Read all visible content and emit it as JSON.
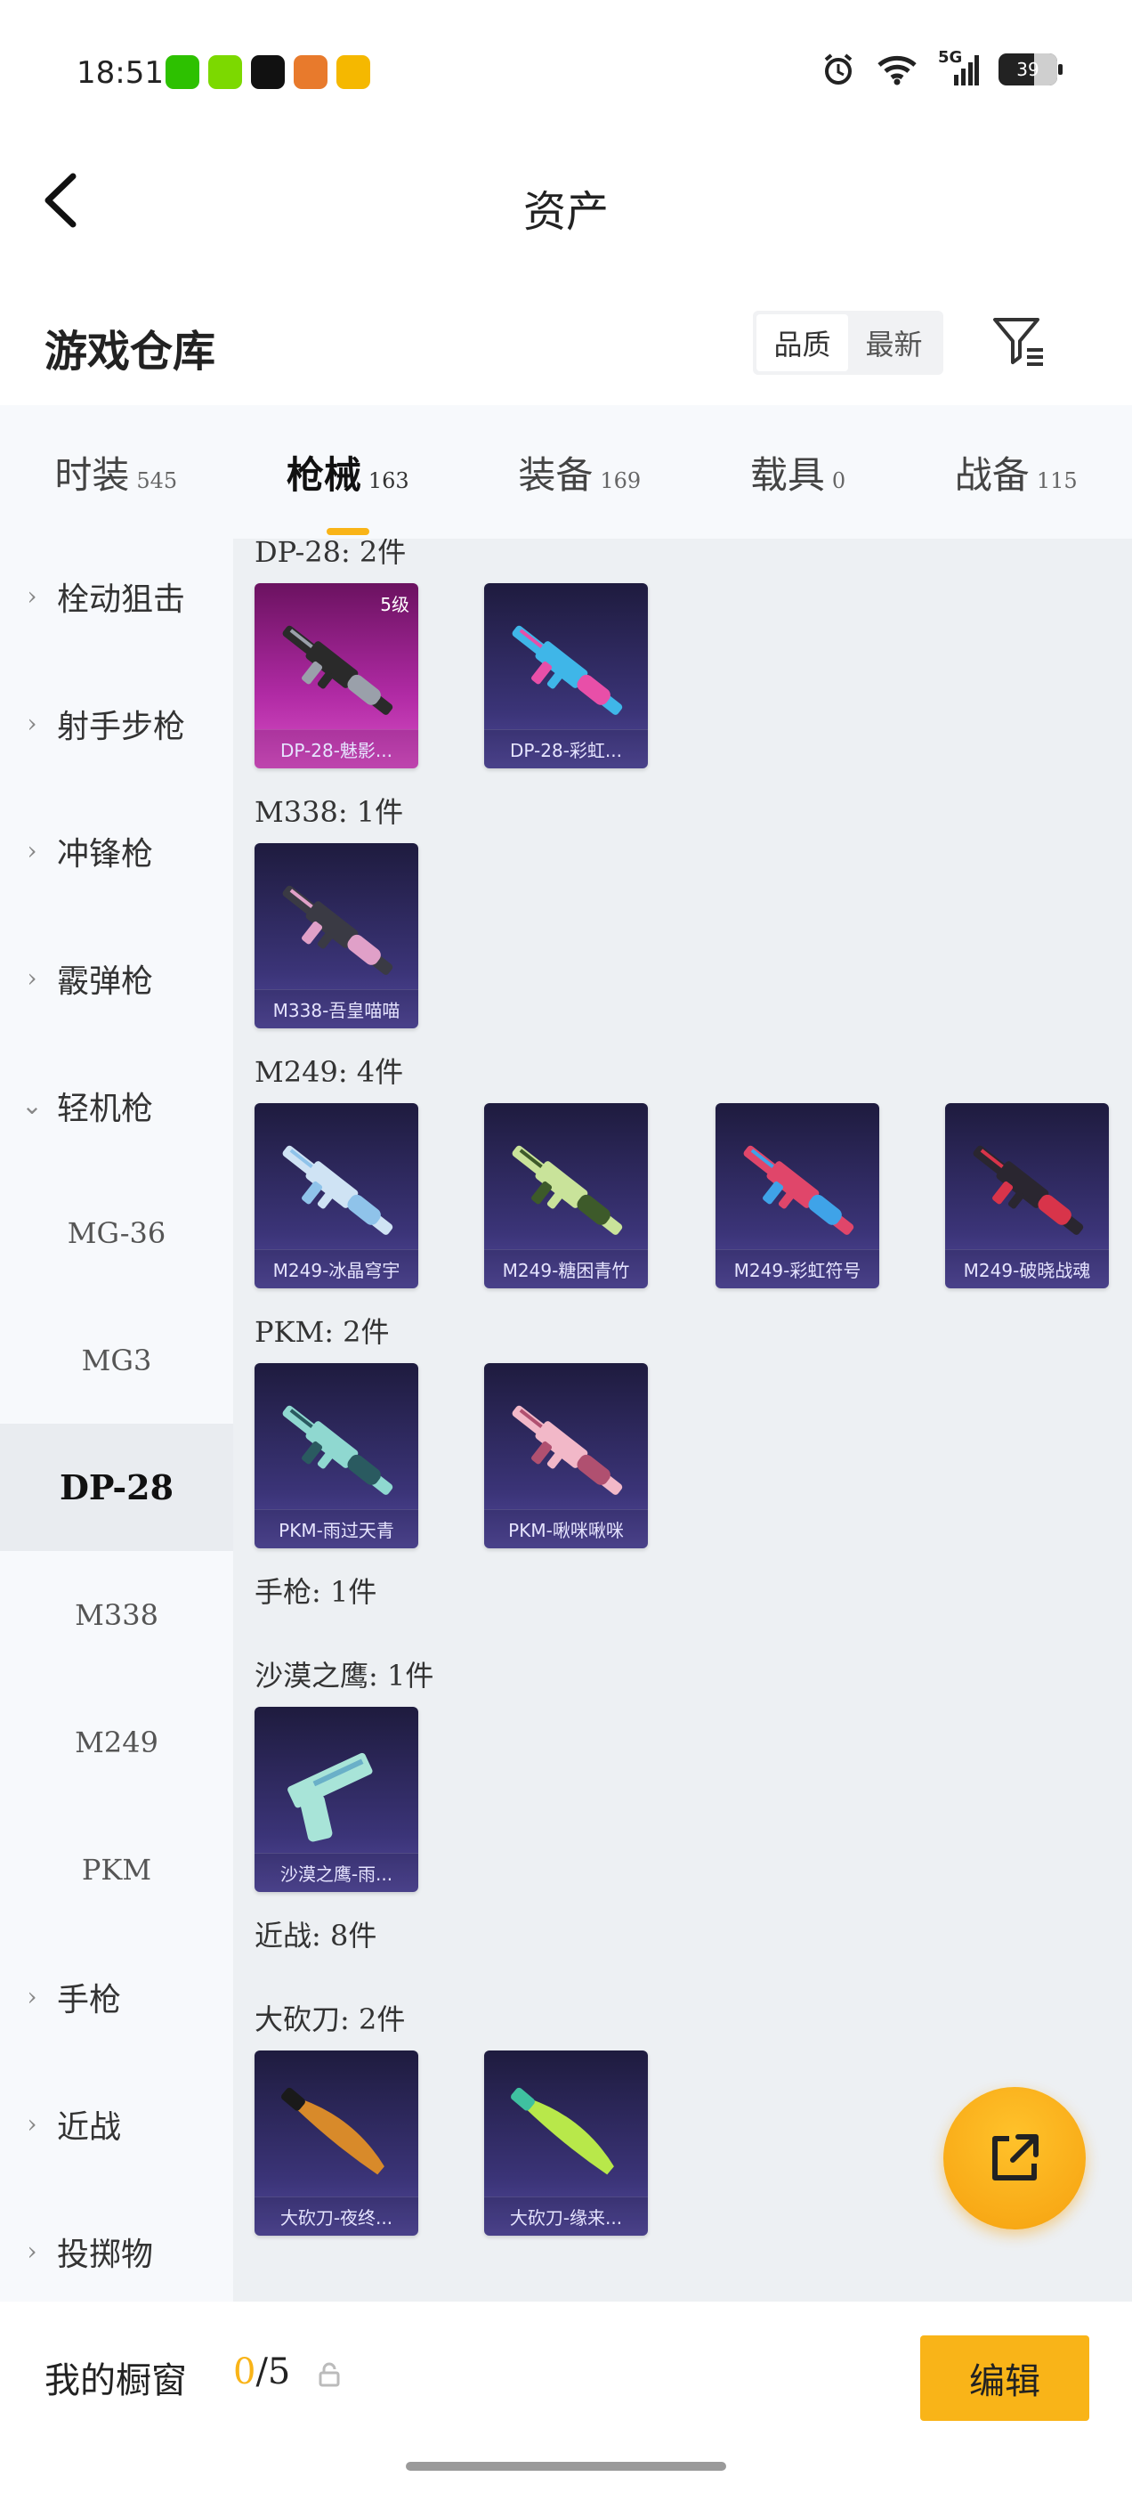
{
  "status_bar": {
    "time": "18:51",
    "battery": "39",
    "network": "5G",
    "app_icons": [
      {
        "name": "wechat-icon",
        "color": "#2dc100"
      },
      {
        "name": "green-dot-app-icon",
        "color": "#7cd900"
      },
      {
        "name": "tiktok-icon",
        "color": "#111111"
      },
      {
        "name": "game-avatar-icon",
        "color": "#e87a2c"
      },
      {
        "name": "weibo-icon",
        "color": "#f5b800"
      }
    ]
  },
  "header": {
    "title": "资产"
  },
  "warehouse": {
    "title": "游戏仓库",
    "sort_options": [
      "品质",
      "最新"
    ],
    "active_sort": "品质"
  },
  "tabs": [
    {
      "label": "时装",
      "count": "545"
    },
    {
      "label": "枪械",
      "count": "163",
      "active": true
    },
    {
      "label": "装备",
      "count": "169"
    },
    {
      "label": "载具",
      "count": "0"
    },
    {
      "label": "战备",
      "count": "115"
    }
  ],
  "sidebar": {
    "items": [
      {
        "label": "栓动狙击",
        "chevron": "›"
      },
      {
        "label": "射手步枪",
        "chevron": "›"
      },
      {
        "label": "冲锋枪",
        "chevron": "›"
      },
      {
        "label": "霰弹枪",
        "chevron": "›"
      },
      {
        "label": "轻机枪",
        "chevron": "⌄"
      },
      {
        "label": "MG-36"
      },
      {
        "label": "MG3"
      },
      {
        "label": "DP-28",
        "selected": true
      },
      {
        "label": "M338"
      },
      {
        "label": "M249"
      },
      {
        "label": "PKM"
      },
      {
        "label": "手枪",
        "chevron": "›"
      },
      {
        "label": "近战",
        "chevron": "›"
      },
      {
        "label": "投掷物",
        "chevron": "›"
      }
    ]
  },
  "content": {
    "groups": [
      {
        "label": "DP-28: 2件",
        "cards": [
          {
            "label": "DP-28-魅影...",
            "level": "5级",
            "style": "pink",
            "weapon_color": "#2a2a2a",
            "accent": "#9aa0aa"
          },
          {
            "label": "DP-28-彩虹...",
            "style": "blue",
            "weapon_color": "#3fb6e8",
            "accent": "#e84fa8"
          }
        ]
      },
      {
        "label": "M338: 1件",
        "cards": [
          {
            "label": "M338-吾皇喵喵",
            "style": "blue",
            "weapon_color": "#3a3a44",
            "accent": "#e0a0c8"
          }
        ]
      },
      {
        "label": "M249: 4件",
        "cards": [
          {
            "label": "M249-冰晶穹宇",
            "style": "blue",
            "weapon_color": "#cfe3f4",
            "accent": "#8fc3ea"
          },
          {
            "label": "M249-糖困青竹",
            "style": "blue",
            "weapon_color": "#c9e39a",
            "accent": "#3d5a2a"
          },
          {
            "label": "M249-彩虹符号",
            "style": "blue",
            "weapon_color": "#e0466a",
            "accent": "#3fa3e8"
          },
          {
            "label": "M249-破晓战魂",
            "style": "blue",
            "weapon_color": "#2a2630",
            "accent": "#d8344a"
          }
        ]
      },
      {
        "label": "PKM: 2件",
        "cards": [
          {
            "label": "PKM-雨过天青",
            "style": "blue",
            "weapon_color": "#8fd8d0",
            "accent": "#2a5a60"
          },
          {
            "label": "PKM-啾咪啾咪",
            "style": "blue",
            "weapon_color": "#f2b8c8",
            "accent": "#b05070"
          }
        ]
      },
      {
        "label": "手枪: 1件",
        "cards": []
      },
      {
        "label": "沙漠之鹰: 1件",
        "cards": [
          {
            "label": "沙漠之鹰-雨...",
            "style": "blue",
            "weapon_color": "#a8e4d8",
            "accent": "#6ab0c8"
          }
        ]
      },
      {
        "label": "近战: 8件",
        "cards": []
      },
      {
        "label": "大砍刀: 2件",
        "cards": [
          {
            "label": "大砍刀-夜终...",
            "style": "blue",
            "weapon_color": "#d88a2a",
            "accent": "#1a1a1a"
          },
          {
            "label": "大砍刀-缘来...",
            "style": "blue",
            "weapon_color": "#b8e84a",
            "accent": "#3fc0a0"
          }
        ]
      }
    ]
  },
  "bottom": {
    "showcase_label": "我的橱窗",
    "showcase_current": "0",
    "showcase_total": "/5",
    "edit_label": "编辑"
  },
  "colors": {
    "accent": "#f9b418",
    "content_bg": "#edf0f3",
    "sidebar_bg": "#f7f9fc"
  }
}
